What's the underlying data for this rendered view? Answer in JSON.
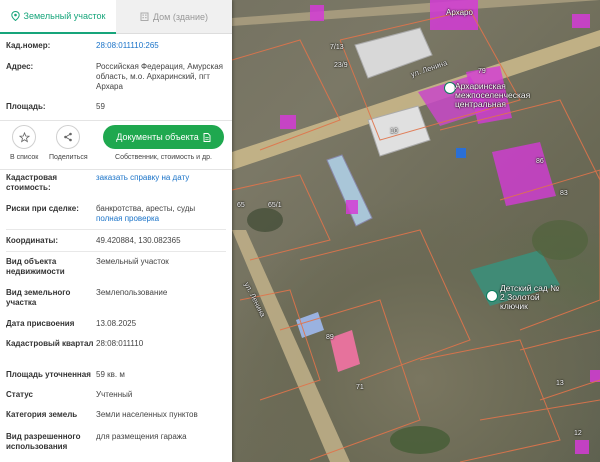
{
  "tabs": {
    "land_plot": "Земельный участок",
    "building": "Дом (здание)"
  },
  "fields": {
    "cad_number": {
      "label": "Кад.номер:",
      "value": "28:08:011110:265"
    },
    "address": {
      "label": "Адрес:",
      "value": "Российская Федерация, Амурская область, м.о. Архаринский, пгт Архара"
    },
    "area": {
      "label": "Площадь:",
      "value": "59"
    },
    "cad_value": {
      "label": "Кадастровая стоимость:",
      "link": "заказать справку на дату"
    },
    "risks": {
      "label": "Риски при сделке:",
      "value": "банкротства, аресты, суды",
      "link": "полная проверка"
    },
    "coords": {
      "label": "Координаты:",
      "value": "49.420884, 130.082365"
    },
    "object_type": {
      "label": "Вид объекта недвижимости",
      "value": "Земельный участок"
    },
    "plot_type": {
      "label": "Вид земельного участка",
      "value": "Землепользование"
    },
    "assigned_date": {
      "label": "Дата присвоения",
      "value": "13.08.2025"
    },
    "cad_quarter": {
      "label": "Кадастровый квартал",
      "value": "28:08:011110"
    },
    "refined_area": {
      "label": "Площадь уточненная",
      "value": "59 кв. м"
    },
    "status": {
      "label": "Статус",
      "value": "Учтенный"
    },
    "land_category": {
      "label": "Категория земель",
      "value": "Земли населенных пунктов"
    },
    "permitted_use": {
      "label": "Вид разрешенного использования",
      "value": "для размещения гаража"
    }
  },
  "actions": {
    "to_list": "В список",
    "share": "Поделиться",
    "docs_button": "Документы объекта",
    "docs_sub": "Собственник, стоимость и др."
  },
  "map": {
    "poi_school": "Архаринская межпоселенческая центральная",
    "poi_kindergarten": "Детский сад № 2 Золотой ключик",
    "street_top_right": "Архаро",
    "street_diag": "ул. Ленина",
    "street_vertical": "ул. Ленина",
    "labels": {
      "n_713": "7/13",
      "n_239": "23/9",
      "n_79": "79",
      "n_10": "10",
      "n_86": "86",
      "n_65": "65",
      "n_65b": "65/1",
      "n_89": "89",
      "n_71": "71",
      "n_13": "13",
      "n_12": "12",
      "n_83": "83"
    }
  },
  "colors": {
    "accent": "#17a57b",
    "button": "#1fa84f",
    "link": "#1a73c8",
    "parcel_highlight": "#d33bd6",
    "parcel_outline": "#e0744b"
  }
}
